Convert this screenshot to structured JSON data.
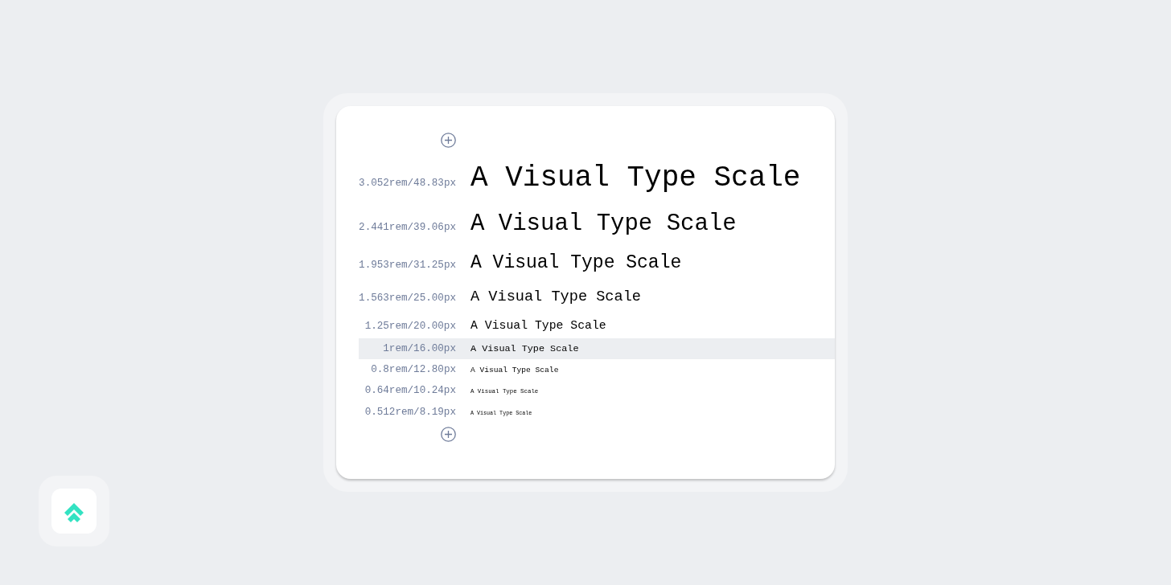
{
  "scale": {
    "rows": [
      {
        "label": "3.052rem/48.83px",
        "sample": "A Visual Type Scale",
        "selected": false
      },
      {
        "label": "2.441rem/39.06px",
        "sample": "A Visual Type Scale",
        "selected": false
      },
      {
        "label": "1.953rem/31.25px",
        "sample": "A Visual Type Scale",
        "selected": false
      },
      {
        "label": "1.563rem/25.00px",
        "sample": "A Visual Type Scale",
        "selected": false
      },
      {
        "label": "1.25rem/20.00px",
        "sample": "A Visual Type Scale",
        "selected": false
      },
      {
        "label": "1rem/16.00px",
        "sample": "A Visual Type Scale",
        "selected": true
      },
      {
        "label": "0.8rem/12.80px",
        "sample": "A Visual Type Scale",
        "selected": false
      },
      {
        "label": "0.64rem/10.24px",
        "sample": "A Visual Type Scale",
        "selected": false
      },
      {
        "label": "0.512rem/8.19px",
        "sample": "A Visual Type Scale",
        "selected": false
      }
    ]
  }
}
